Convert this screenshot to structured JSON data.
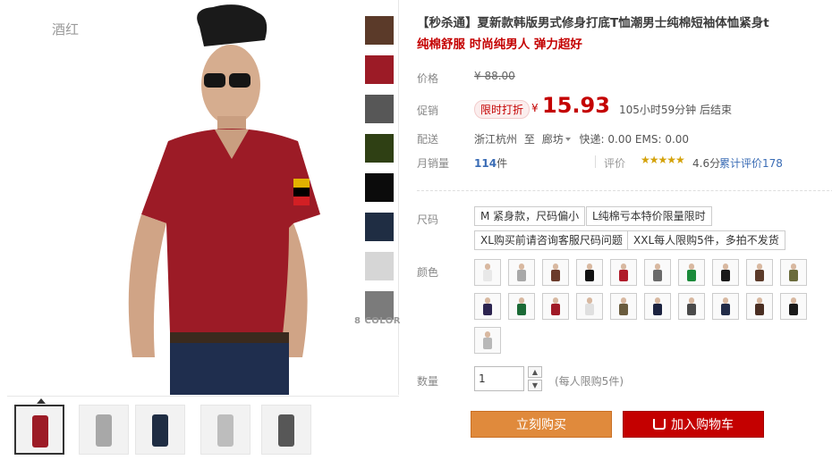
{
  "product": {
    "image_caption": "酒红",
    "color_count_label": "8 COLOR",
    "swatch_colors": [
      "#5b3a29",
      "#9c1b26",
      "#575757",
      "#2f4014",
      "#0b0b0b",
      "#1f2d43",
      "#d6d6d6",
      "#7b7b7b"
    ],
    "thumbnails": [
      "thumb-1",
      "thumb-2",
      "thumb-3",
      "thumb-4",
      "thumb-5"
    ],
    "title_line1": "【秒杀通】夏新款韩版男式修身打底T恤潮男士纯棉短袖体恤紧身t",
    "title_line2": "纯棉舒服 时尚纯男人 弹力超好"
  },
  "pricing": {
    "price_label": "价格",
    "original_price": "¥ 88.00",
    "promo_label": "促销",
    "promo_tag": "限时打折",
    "currency": "¥",
    "current_price": "15.93",
    "countdown": "105小时59分钟 后结束"
  },
  "delivery": {
    "label": "配送",
    "from": "浙江杭州",
    "to_word": "至",
    "to": "廊坊",
    "fees": "快递: 0.00 EMS: 0.00"
  },
  "stats": {
    "monthly_label": "月销量",
    "monthly_value": "114",
    "monthly_unit": "件",
    "rating_label": "评价",
    "stars": "★★★★★",
    "rating": "4.6分",
    "reviews": "累计评价178"
  },
  "options": {
    "size_label": "尺码",
    "sizes": [
      "M 紧身款，尺码偏小",
      "L纯棉亏本特价限量限时",
      "XL购买前请咨询客服尺码问题",
      "XXL每人限购5件，多拍不发货"
    ],
    "color_label": "颜色",
    "color_chips": [
      "#e8e8e8",
      "#a8a8a8",
      "#6b3b2b",
      "#111111",
      "#b01c2a",
      "#6a6a6a",
      "#1b8a3a",
      "#1a1a1a",
      "#5b3a29",
      "#6a6b3c",
      "#2c2450",
      "#1b6a36",
      "#a01a26",
      "#e0e0e0",
      "#6a5c3e",
      "#1c2340",
      "#4a4a4a",
      "#222c48",
      "#4a2e22",
      "#1a1a1a",
      "#b8b8b8"
    ]
  },
  "quantity": {
    "label": "数量",
    "value": "1",
    "note": "(每人限购5件)"
  },
  "actions": {
    "buy_now": "立刻购买",
    "add_to_cart": "加入购物车"
  }
}
